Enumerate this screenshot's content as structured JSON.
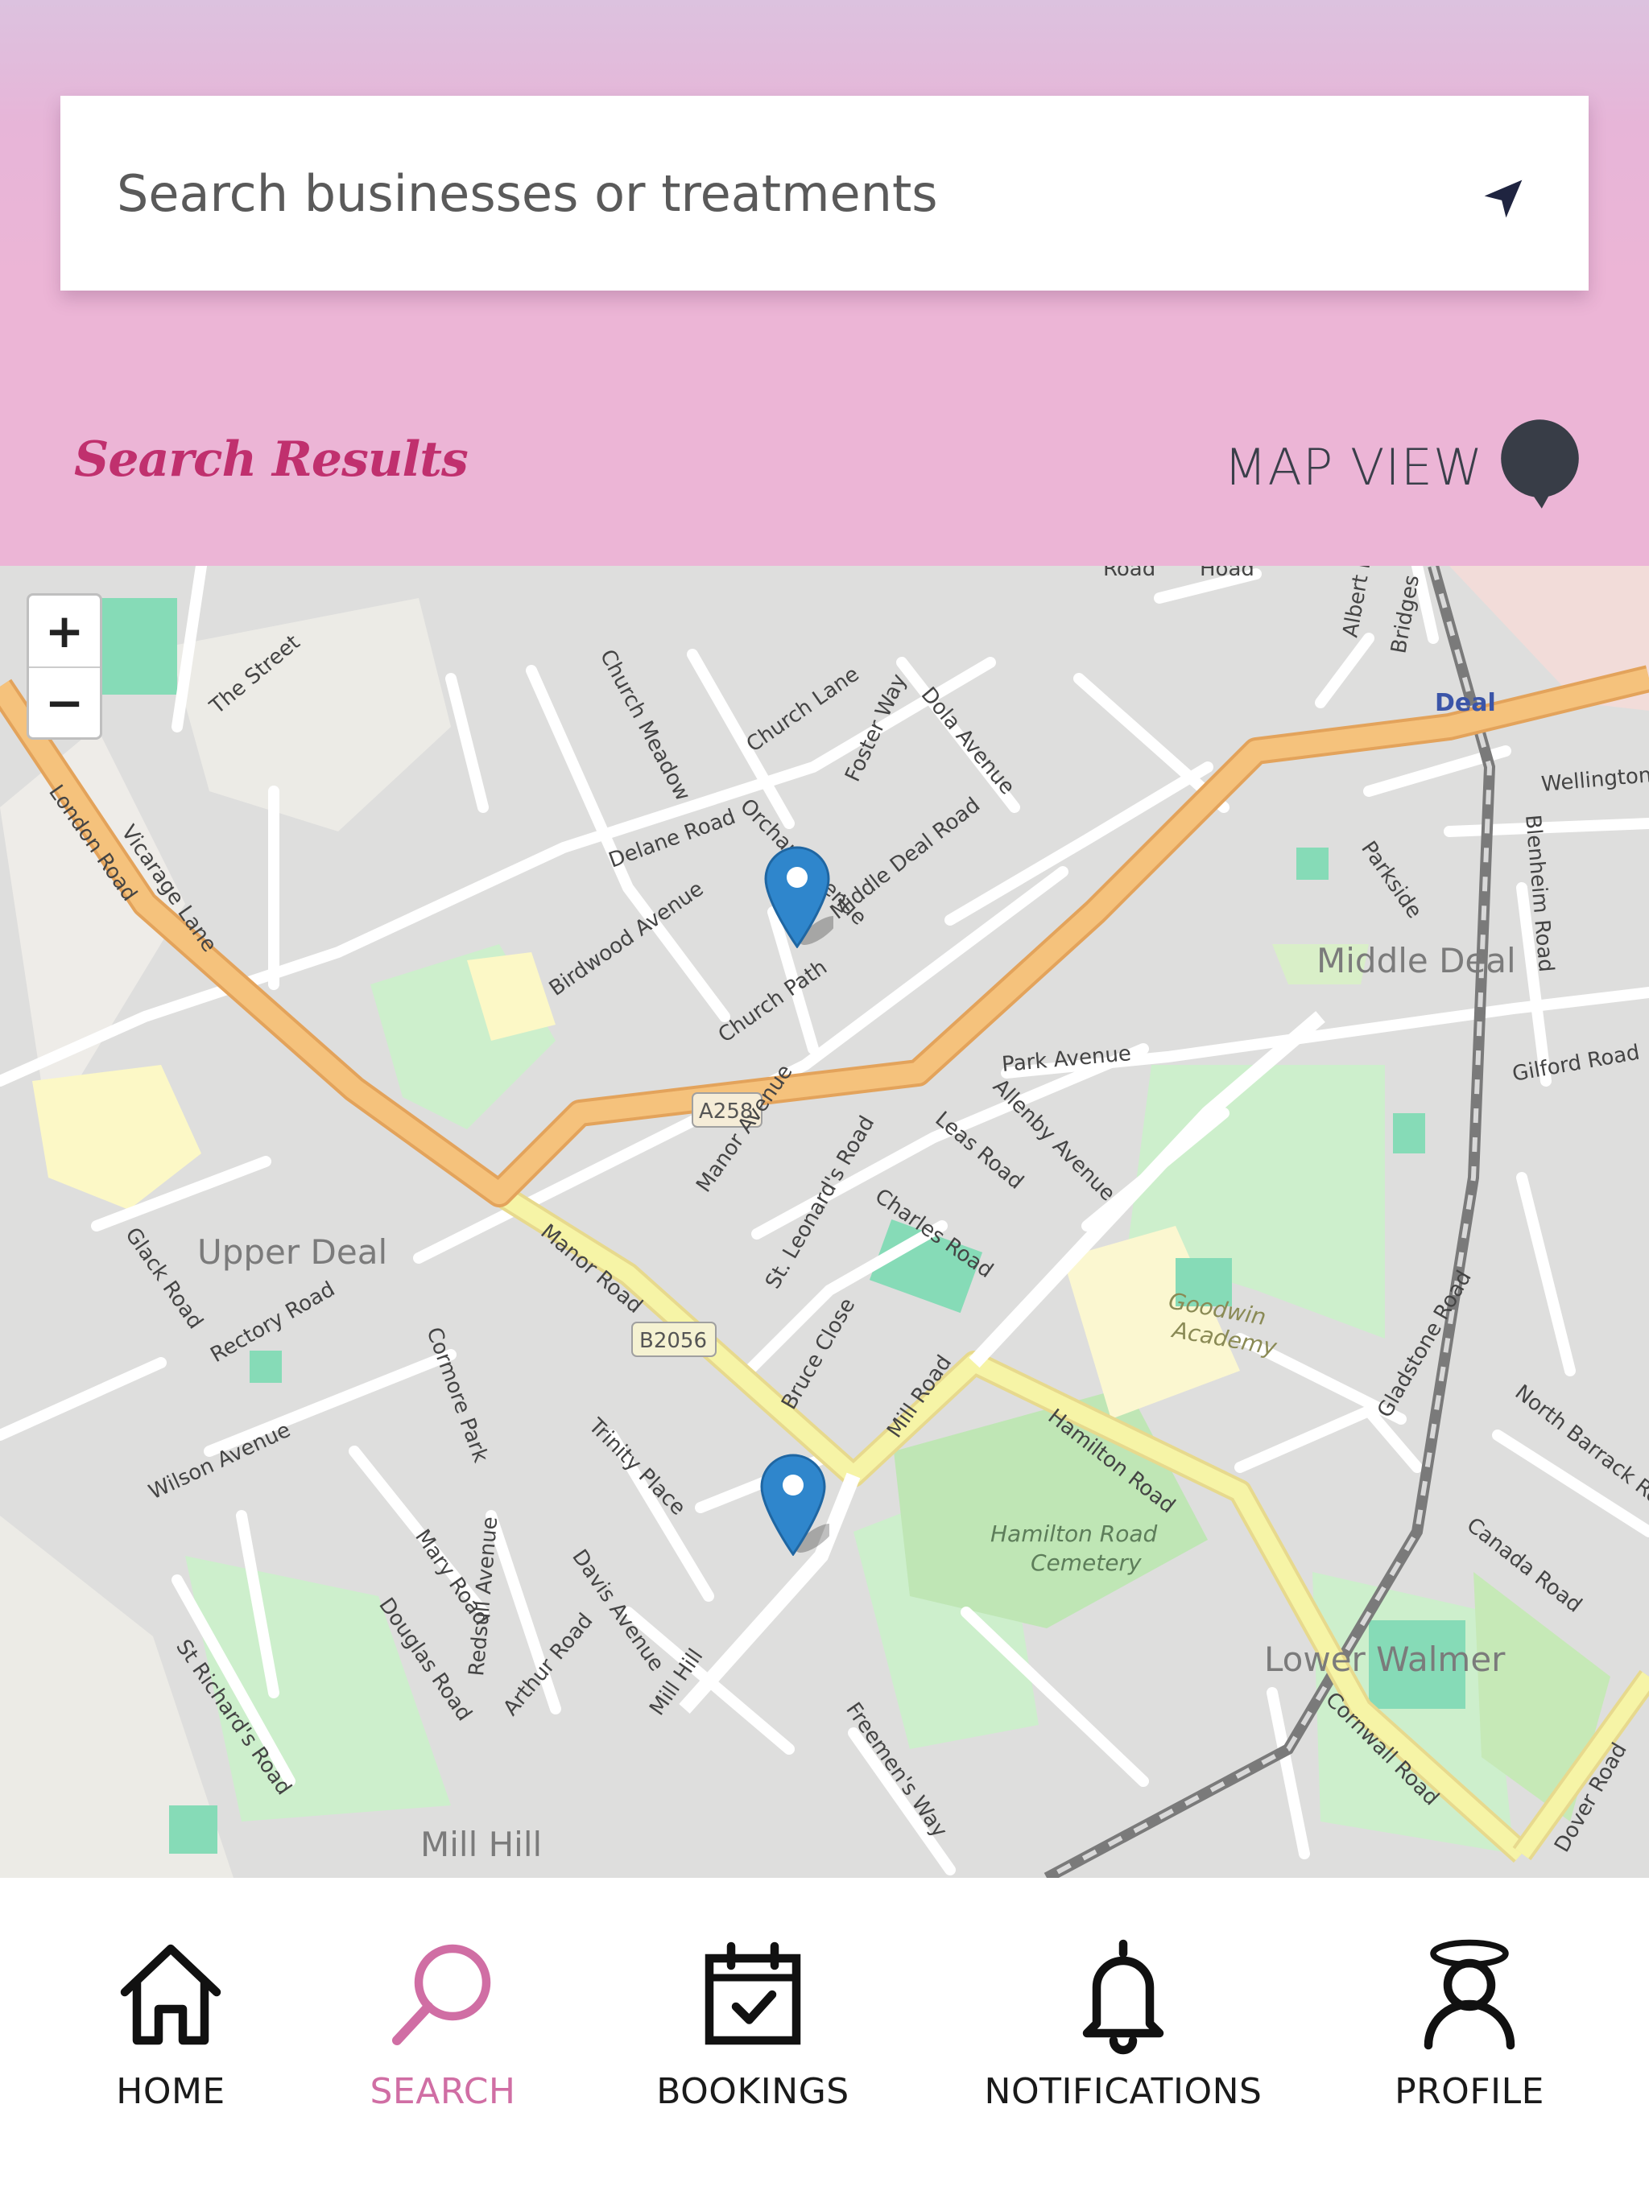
{
  "header": {
    "search_placeholder": "Search businesses or treatments",
    "results_title": "Search Results",
    "map_view_label": "MAP VIEW"
  },
  "map": {
    "zoom_in": "+",
    "zoom_out": "−",
    "place_labels": [
      "Deal",
      "Middle Deal",
      "Upper Deal",
      "Lower Walmer",
      "Mill Hill",
      "Goodwin Academy",
      "Hamilton Road Cemetery"
    ],
    "road_labels": [
      "London Road",
      "Manor Road",
      "Mill Road",
      "Hamilton Road",
      "Park Avenue",
      "Middle Deal Road",
      "Church Path",
      "Church Lane",
      "Delane Road",
      "Birdwood Avenue",
      "Orchard Avenue",
      "Foster Way",
      "Dola Avenue",
      "Church Meadow",
      "The Street",
      "Vicarage Lane",
      "Rectory Road",
      "Glack Road",
      "Cormore Park",
      "Trinity Place",
      "Davis Avenue",
      "Mary Road",
      "Douglas Road",
      "Redsull Avenue",
      "Arthur Road",
      "St Richard's Road",
      "Wilson Avenue",
      "Mill Hill",
      "Freemen's Way",
      "Bruce Close",
      "St. Leonard's Road",
      "Manor Avenue",
      "Leas Road",
      "Allenby Avenue",
      "Charles Road",
      "Cornwall Road",
      "Dover Road",
      "Gladstone Road",
      "Canada Road",
      "North Barrack Road",
      "Gilford Road",
      "Blenheim Road",
      "Wellington Road",
      "Parkside",
      "Albert Road",
      "Bridges",
      "Road",
      "Hoad"
    ],
    "road_shields": [
      "A258",
      "B2056"
    ],
    "markers": [
      "business-1",
      "business-2"
    ],
    "colors": {
      "main_road": "#f5c27c",
      "secondary_road": "#f6f4a6",
      "park": "#cdf0cc",
      "pitch": "#86dbb7",
      "marker": "#2f86cc"
    }
  },
  "nav": {
    "items": [
      {
        "label": "HOME",
        "icon": "home-icon"
      },
      {
        "label": "SEARCH",
        "icon": "search-icon",
        "active": true
      },
      {
        "label": "BOOKINGS",
        "icon": "calendar-check-icon"
      },
      {
        "label": "NOTIFICATIONS",
        "icon": "bell-icon"
      },
      {
        "label": "PROFILE",
        "icon": "profile-icon"
      }
    ],
    "active_color": "#d06ea4"
  }
}
